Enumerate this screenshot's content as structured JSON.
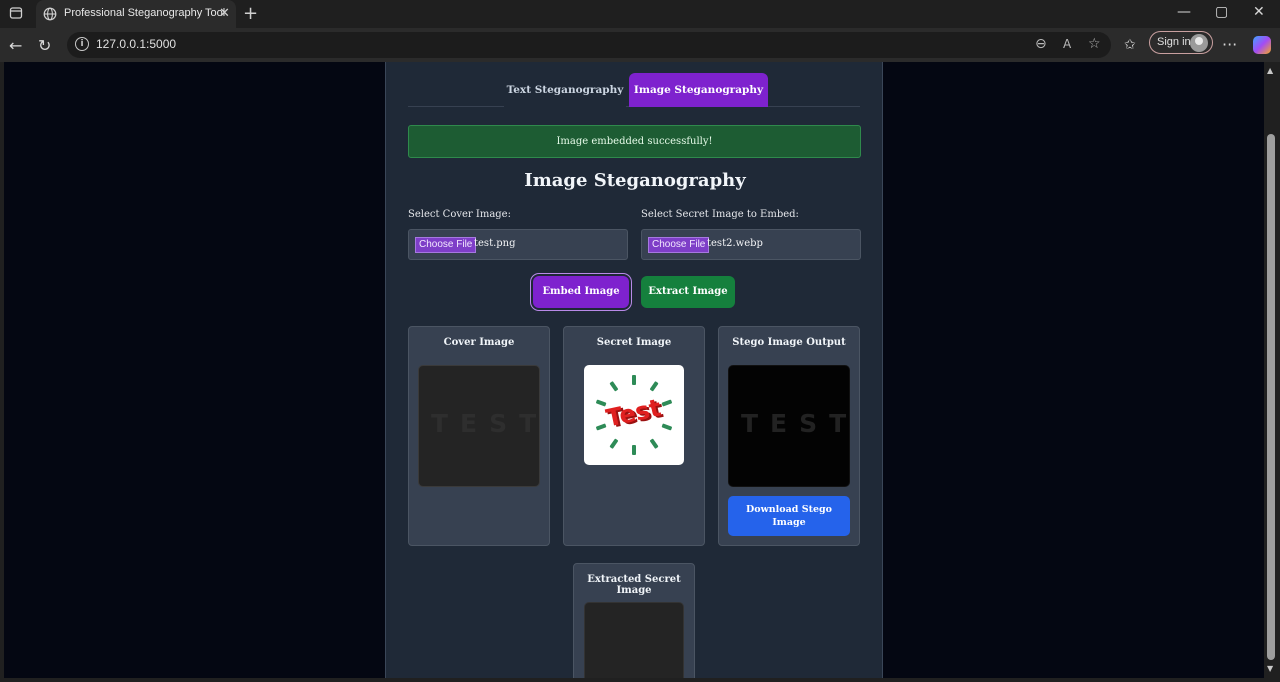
{
  "browser": {
    "tab_title": "Professional Steganography Tool",
    "tab_close": "✕",
    "new_tab": "+",
    "url": "127.0.0.1:5000",
    "sign_in": "Sign in",
    "window_controls": {
      "minimize": "—",
      "maximize": "▢",
      "close": "✕"
    },
    "nav": {
      "back": "←",
      "refresh": "↻",
      "more": "···"
    },
    "url_icons": {
      "zoom": "⊖",
      "read_aloud": "A",
      "favorite": "☆",
      "favorites": "✩"
    }
  },
  "app": {
    "tabs": [
      {
        "label": "Text Steganography",
        "active": false
      },
      {
        "label": "Image Steganography",
        "active": true
      }
    ],
    "alert": "Image embedded successfully!",
    "heading": "Image Steganography",
    "cover_label": "Select Cover Image:",
    "secret_label": "Select Secret Image to Embed:",
    "choose_file": "Choose File",
    "cover_file": "test.png",
    "secret_file": "test2.webp",
    "embed_button": "Embed Image",
    "extract_button": "Extract Image",
    "panels": {
      "cover": "Cover Image",
      "secret": "Secret Image",
      "stego": "Stego Image Output",
      "extracted": "Extracted Secret Image"
    },
    "image_text": "TEST",
    "secret_image_text": "Test",
    "download_button": "Download Stego Image"
  },
  "colors": {
    "accent_purple": "#7e22ce",
    "success_green": "#15803d",
    "download_blue": "#2563eb",
    "card_bg": "#1f2937",
    "page_bg": "#040712"
  }
}
